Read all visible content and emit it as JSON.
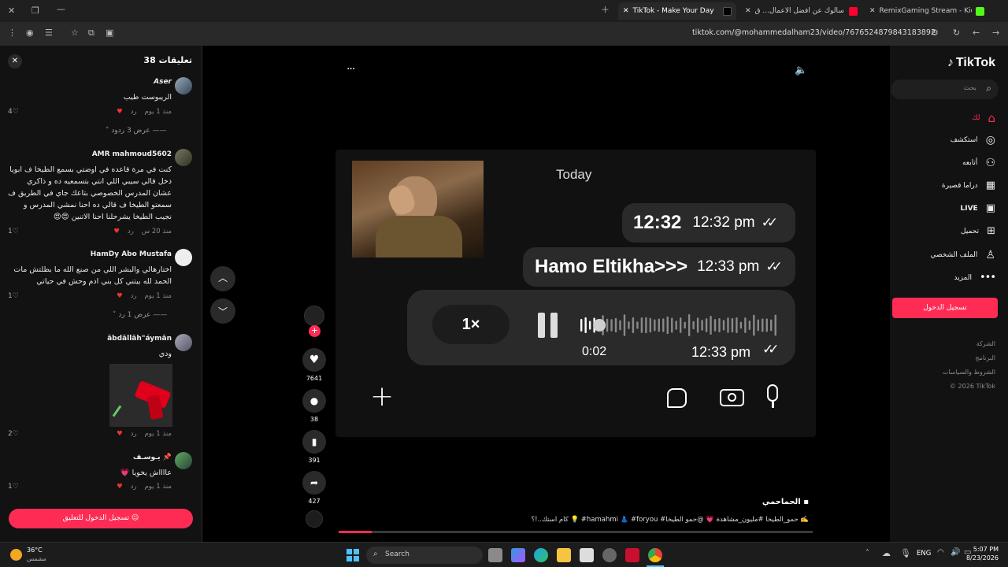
{
  "browser": {
    "tabs": [
      {
        "label": "RemixGaming Stream - Kick Da"
      },
      {
        "label": "وإن سألوك عن أفضل الأعمال... ق"
      },
      {
        "label": "TikTok - Make Your Day"
      }
    ],
    "url": "tiktok.com/@mohammedalham23/video/7676524879843183892"
  },
  "comments": {
    "title": "تعليقات 38",
    "items": [
      {
        "name": "Aser",
        "text": "الريبوست طيب",
        "time": "منذ 1 يوم",
        "reply": "رد",
        "likes": "4",
        "replies": "عرض 3 ردود"
      },
      {
        "name": "AMR mahmoud5602",
        "text": "كنت في مرة قاعده في اوضتي بسمع الطيخا ف ابويا دخل قالي سيبي اللي انتي بتسمعيه ده و ذاكري عشان المدرس الخصوصي بتاعك جاي في الطريق ف سمعتو الطيخا ف قالي ده احنا نمشي المدرس و نجيب الطيخا يشرحلنا احنا الاتنين 😍😍",
        "time": "منذ 20 س",
        "reply": "رد",
        "likes": "1"
      },
      {
        "name": "HamDy Abo Mustafa",
        "text": "اختارهالي والبشر اللي من صنع الله ما بطلتش مات الحمد لله بيتني كل بني ادم وحش في حياتي",
        "time": "منذ 1 يوم",
        "reply": "رد",
        "likes": "1",
        "replies": "عرض 1 رد"
      },
      {
        "name": "ābdāllāh\"áymān",
        "text": "ودي",
        "time": "منذ 1 يوم",
        "reply": "رد",
        "likes": "2"
      },
      {
        "name": "يـوسـف 📌",
        "text": "عااااش يخويا 💗",
        "time": "منذ 1 يوم",
        "reply": "رد",
        "likes": "1"
      }
    ],
    "login_button": "تسجيل الدخول للتعليق"
  },
  "video": {
    "more_label": "···",
    "chat": {
      "today": "Today",
      "messages": [
        {
          "text": "12:32",
          "time": "12:32 pm"
        },
        {
          "text": "Hamo Eltikha>>>",
          "time": "12:33 pm"
        }
      ],
      "voice": {
        "speed": "1×",
        "elapsed": "0:02",
        "time": "12:33 pm",
        "progress": 0.08
      }
    },
    "actions": {
      "likes": "7641",
      "comments": "38",
      "saves": "391",
      "shares": "427"
    },
    "author": "الحماحمي",
    "caption": "كام استك..!؟ 💡 #hamahmi 👗 #foryou #حمو_الطيخا #مليون_مشاهدة 💗 @حمو الطيخا ✍️",
    "playback_progress": 0.07
  },
  "nav": {
    "logo": "TikTok",
    "search_placeholder": "بحث",
    "items": [
      {
        "label": "لك"
      },
      {
        "label": "استكشف"
      },
      {
        "label": "أتابعه"
      },
      {
        "label": "دراما قصيرة"
      },
      {
        "label": "LIVE"
      },
      {
        "label": "تحميل"
      },
      {
        "label": "الملف الشخصي"
      },
      {
        "label": "المزيد"
      }
    ],
    "login_button": "تسجيل الدخول",
    "footer": [
      "الشركة",
      "البرنامج",
      "الشروط والسياسات",
      "© 2026 TikTok"
    ]
  },
  "taskbar": {
    "weather_temp": "36°C",
    "weather_desc": "مشمس",
    "search": "Search",
    "lang": "ENG",
    "time": "5:07 PM",
    "date": "8/23/2026"
  },
  "colors": {
    "accent": "#fe2c55",
    "bubble": "#2a2a2a"
  }
}
